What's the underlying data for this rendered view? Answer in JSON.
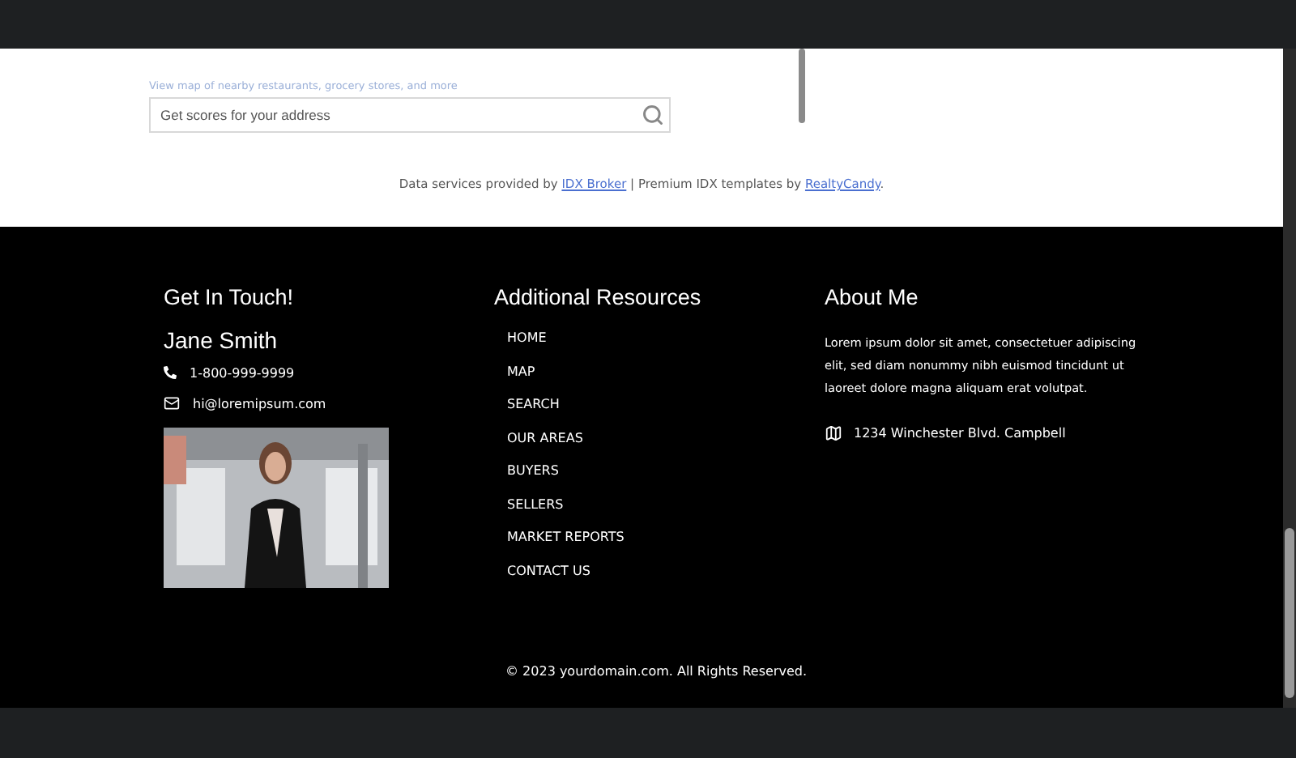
{
  "walk_score": {
    "caption": "View map of nearby restaurants, grocery stores, and more",
    "search": {
      "placeholder": "Get scores for your address"
    }
  },
  "credits": {
    "before": "Data services provided by",
    "link_1": "IDX Broker",
    "middle": "| Premium IDX templates by",
    "link_2": "RealtyCandy",
    "after": "."
  },
  "contact": {
    "heading": "Get In Touch!",
    "name": "Jane Smith",
    "phone": "1-800-999-9999",
    "email": "hi@loremipsum.com"
  },
  "resources": {
    "heading": "Additional Resources",
    "links": [
      "HOME",
      "MAP",
      "SEARCH",
      "OUR AREAS",
      "BUYERS",
      "SELLERS",
      "MARKET REPORTS",
      "CONTACT US"
    ]
  },
  "about": {
    "heading": "About Me",
    "text": "Lorem ipsum dolor sit amet, consectetuer adipiscing elit, sed diam nonummy nibh euismod tincidunt ut laoreet dolore magna aliquam erat volutpat.",
    "address": "1234 Winchester Blvd. Campbell"
  },
  "copyright": "© 2023 yourdomain.com. All Rights Reserved."
}
